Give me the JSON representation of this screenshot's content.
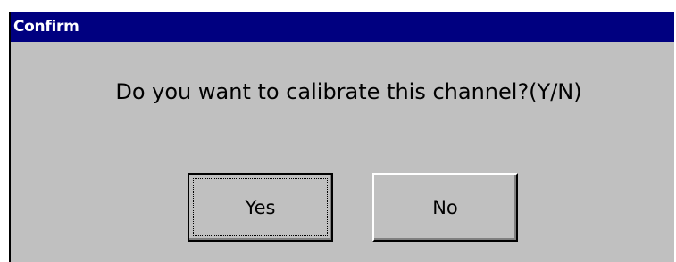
{
  "dialog": {
    "title": "Confirm",
    "message": "Do you want to calibrate this channel?(Y/N)",
    "buttons": {
      "yes_label": "Yes",
      "no_label": "No"
    }
  },
  "colors": {
    "titlebar": "#000080",
    "dialog_background": "#c0c0c0",
    "title_text": "#ffffff"
  }
}
